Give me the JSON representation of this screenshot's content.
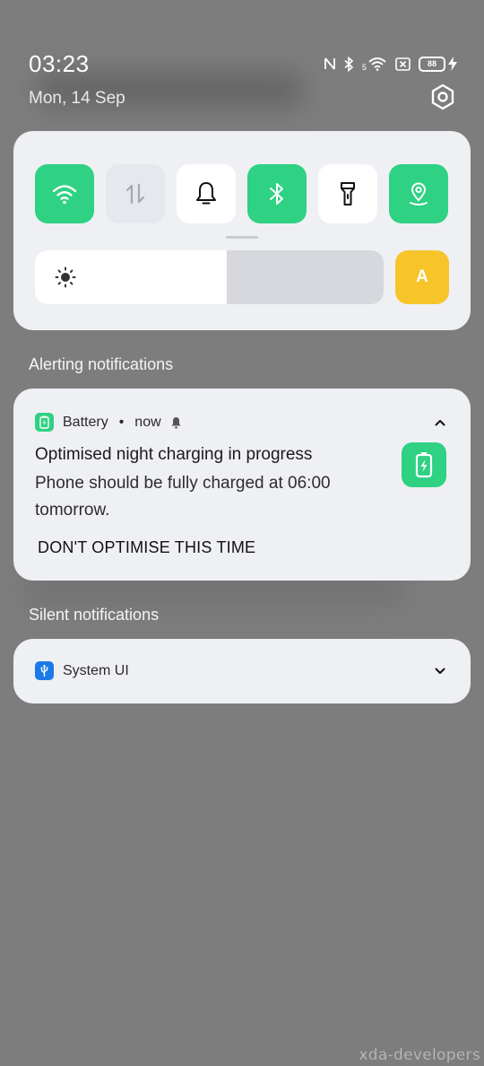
{
  "status_bar": {
    "time": "03:23",
    "date": "Mon, 14 Sep",
    "network_label": "5",
    "battery_level": "88",
    "icons": [
      "nfc-icon",
      "bluetooth-icon",
      "wifi-5g-icon",
      "sim-off-icon",
      "battery-icon",
      "charging-bolt-icon"
    ]
  },
  "quick_settings": {
    "tiles": [
      {
        "name": "wifi",
        "state": "on",
        "icon": "wifi-icon"
      },
      {
        "name": "mobile-data",
        "state": "disabled",
        "icon": "data-arrows-icon"
      },
      {
        "name": "sound",
        "state": "off",
        "icon": "bell-icon"
      },
      {
        "name": "bluetooth",
        "state": "on",
        "icon": "bluetooth-icon"
      },
      {
        "name": "flashlight",
        "state": "off",
        "icon": "flashlight-icon"
      },
      {
        "name": "location",
        "state": "on",
        "icon": "location-icon"
      }
    ],
    "brightness_level": 0.55,
    "auto_brightness_label": "A"
  },
  "alerting": {
    "section_label": "Alerting notifications",
    "app_name": "Battery",
    "separator": "•",
    "time": "now",
    "title": "Optimised night charging in progress",
    "body": "Phone should be fully charged at 06:00 tomorrow.",
    "action_label": "DON'T OPTIMISE THIS TIME"
  },
  "silent": {
    "section_label": "Silent notifications",
    "app_name": "System UI"
  },
  "watermark": "xda-developers",
  "colors": {
    "accent_green": "#2fd183",
    "auto_yellow": "#f7c52a",
    "system_blue": "#1a7ae8",
    "panel_bg": "#eff0f4",
    "scrim": "#7d7d7d"
  }
}
